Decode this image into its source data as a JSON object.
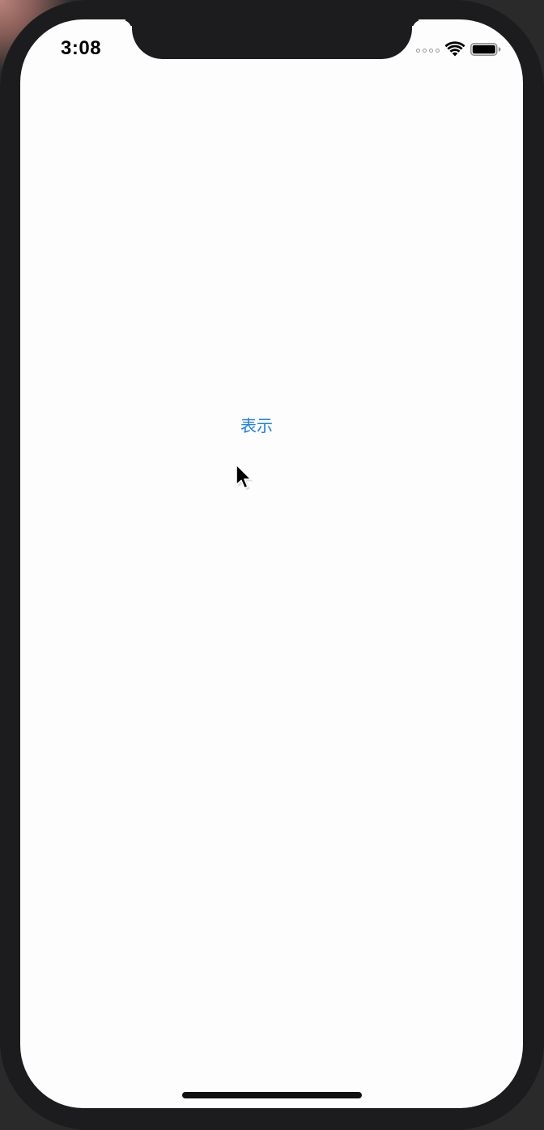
{
  "status_bar": {
    "time": "3:08",
    "signal_icon": "cellular-dots-icon",
    "wifi_icon": "wifi-icon",
    "battery_icon": "battery-icon",
    "battery_level": 1.0
  },
  "main": {
    "show_button_label": "表示"
  },
  "colors": {
    "accent": "#1a7df0",
    "screen_background": "#fdfdfd",
    "device_frame": "#1c1c1e"
  }
}
